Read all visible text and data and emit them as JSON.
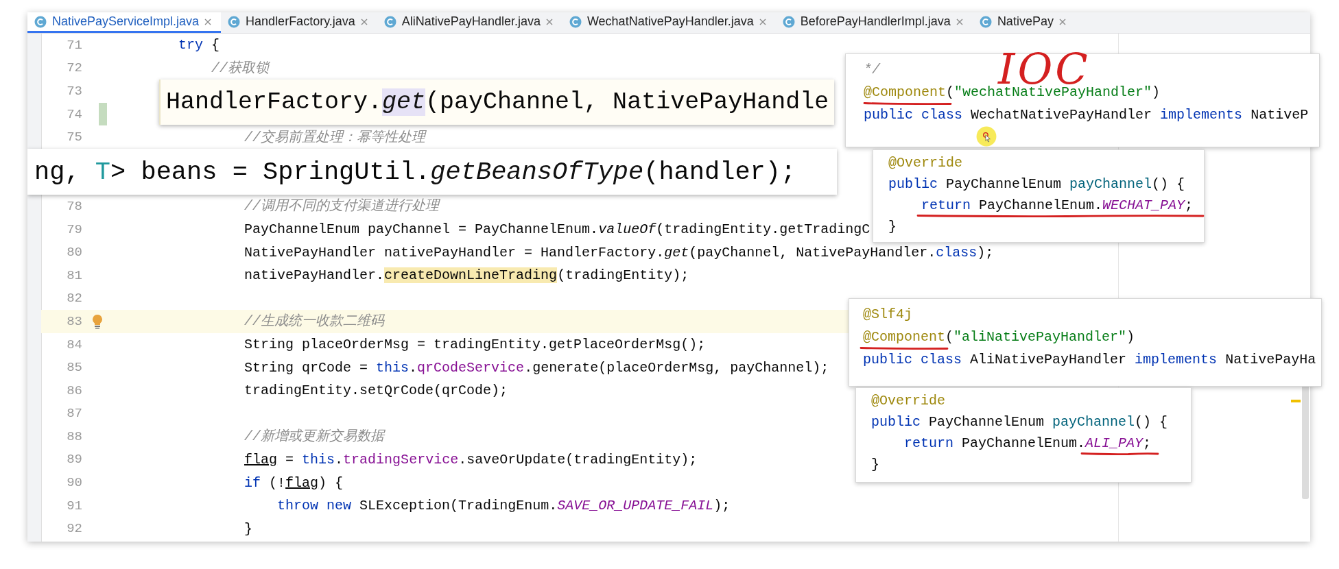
{
  "tabs": [
    {
      "label": "NativePayServiceImpl.java",
      "selected": true
    },
    {
      "label": "HandlerFactory.java",
      "selected": false
    },
    {
      "label": "AliNativePayHandler.java",
      "selected": false
    },
    {
      "label": "WechatNativePayHandler.java",
      "selected": false
    },
    {
      "label": "BeforePayHandlerImpl.java",
      "selected": false
    },
    {
      "label": "NativePay",
      "selected": false
    }
  ],
  "zoom_callout": {
    "tokens": [
      {
        "text": "HandlerFactory.",
        "kind": "plain"
      },
      {
        "text": "get",
        "kind": "static_highlight"
      },
      {
        "text": "(payChannel, NativePayHandle",
        "kind": "plain"
      }
    ]
  },
  "editor": {
    "rows": [
      {
        "kind": "line",
        "number": "71",
        "current": false,
        "changed": false,
        "bulb": false,
        "tokens": [
          {
            "text": "        try",
            "kind": "keyword"
          },
          {
            "text": " {",
            "kind": "plain"
          }
        ]
      },
      {
        "kind": "line",
        "number": "72",
        "current": false,
        "changed": false,
        "bulb": false,
        "tokens": [
          {
            "text": "            //获取锁",
            "kind": "comment"
          }
        ]
      },
      {
        "kind": "line",
        "number": "73",
        "current": false,
        "changed": false,
        "bulb": false
      },
      {
        "kind": "line",
        "number": "74",
        "current": false,
        "changed": true,
        "bulb": false
      },
      {
        "kind": "line",
        "number": "75",
        "current": false,
        "changed": false,
        "bulb": false,
        "tokens": [
          {
            "text": "                //交易前置处理：幂等性处理",
            "kind": "comment"
          }
        ]
      },
      {
        "kind": "zoom_callout",
        "tokens": [
          {
            "text": "ng, ",
            "kind": "plain"
          },
          {
            "text": "T",
            "kind": "type_param"
          },
          {
            "text": "> beans = SpringUtil.",
            "kind": "plain"
          },
          {
            "text": "getBeansOfType",
            "kind": "static"
          },
          {
            "text": "(handler);",
            "kind": "plain"
          }
        ]
      },
      {
        "kind": "line",
        "number": "78",
        "current": false,
        "changed": false,
        "bulb": false,
        "tokens": [
          {
            "text": "                //调用不同的支付渠道进行处理",
            "kind": "comment"
          }
        ]
      },
      {
        "kind": "line",
        "number": "79",
        "current": false,
        "changed": false,
        "bulb": false,
        "tokens": [
          {
            "text": "                PayChannelEnum payChannel = PayChannelEnum.",
            "kind": "plain"
          },
          {
            "text": "valueOf",
            "kind": "static"
          },
          {
            "text": "(tradingEntity.getTradingC",
            "kind": "plain"
          }
        ]
      },
      {
        "kind": "line",
        "number": "80",
        "current": false,
        "changed": false,
        "bulb": false,
        "tokens": [
          {
            "text": "                NativePayHandler nativePayHandler = HandlerFactory.",
            "kind": "plain"
          },
          {
            "text": "get",
            "kind": "static"
          },
          {
            "text": "(payChannel, NativePayHandler.",
            "kind": "plain"
          },
          {
            "text": "class",
            "kind": "keyword"
          },
          {
            "text": ");",
            "kind": "plain"
          }
        ]
      },
      {
        "kind": "line",
        "number": "81",
        "current": false,
        "changed": false,
        "bulb": false,
        "tokens": [
          {
            "text": "                nativePayHandler.",
            "kind": "plain"
          },
          {
            "text": "createDownLineTrading",
            "kind": "highlight"
          },
          {
            "text": "(tradingEntity);",
            "kind": "plain"
          }
        ]
      },
      {
        "kind": "line",
        "number": "82",
        "current": false,
        "changed": false,
        "bulb": false
      },
      {
        "kind": "line",
        "number": "83",
        "current": true,
        "changed": false,
        "bulb": true,
        "tokens": [
          {
            "text": "                //生成统一收款二维码",
            "kind": "comment"
          }
        ]
      },
      {
        "kind": "line",
        "number": "84",
        "current": false,
        "changed": false,
        "bulb": false,
        "tokens": [
          {
            "text": "                String placeOrderMsg = tradingEntity.getPlaceOrderMsg();",
            "kind": "plain"
          }
        ]
      },
      {
        "kind": "line",
        "number": "85",
        "current": false,
        "changed": false,
        "bulb": false,
        "tokens": [
          {
            "text": "                String qrCode = ",
            "kind": "plain"
          },
          {
            "text": "this",
            "kind": "keyword"
          },
          {
            "text": ".",
            "kind": "plain"
          },
          {
            "text": "qrCodeService",
            "kind": "field"
          },
          {
            "text": ".generate(placeOrderMsg, payChannel);",
            "kind": "plain"
          }
        ]
      },
      {
        "kind": "line",
        "number": "86",
        "current": false,
        "changed": false,
        "bulb": false,
        "tokens": [
          {
            "text": "                tradingEntity.setQrCode(qrCode);",
            "kind": "plain"
          }
        ]
      },
      {
        "kind": "line",
        "number": "87",
        "current": false,
        "changed": false,
        "bulb": false
      },
      {
        "kind": "line",
        "number": "88",
        "current": false,
        "changed": false,
        "bulb": false,
        "tokens": [
          {
            "text": "                //新增或更新交易数据",
            "kind": "comment"
          }
        ]
      },
      {
        "kind": "line",
        "number": "89",
        "current": false,
        "changed": false,
        "bulb": false,
        "tokens": [
          {
            "text": "                flag",
            "kind": "underlined"
          },
          {
            "text": " = ",
            "kind": "plain"
          },
          {
            "text": "this",
            "kind": "keyword"
          },
          {
            "text": ".",
            "kind": "plain"
          },
          {
            "text": "tradingService",
            "kind": "field"
          },
          {
            "text": ".saveOrUpdate(tradingEntity);",
            "kind": "plain"
          }
        ]
      },
      {
        "kind": "line",
        "number": "90",
        "current": false,
        "changed": false,
        "bulb": false,
        "tokens": [
          {
            "text": "                if",
            "kind": "keyword"
          },
          {
            "text": " (!",
            "kind": "plain"
          },
          {
            "text": "flag",
            "kind": "underlined"
          },
          {
            "text": ") {",
            "kind": "plain"
          }
        ]
      },
      {
        "kind": "line",
        "number": "91",
        "current": false,
        "changed": false,
        "bulb": false,
        "tokens": [
          {
            "text": "                    throw new",
            "kind": "keyword"
          },
          {
            "text": " SLException(TradingEnum.",
            "kind": "plain"
          },
          {
            "text": "SAVE_OR_UPDATE_FAIL",
            "kind": "enum"
          },
          {
            "text": ");",
            "kind": "plain"
          }
        ]
      },
      {
        "kind": "line",
        "number": "92",
        "current": false,
        "changed": false,
        "bulb": false,
        "tokens": [
          {
            "text": "                }",
            "kind": "plain"
          }
        ]
      }
    ]
  },
  "peek_popups": [
    {
      "lines": [
        [
          {
            "text": "*/",
            "kind": "comment"
          }
        ],
        [
          {
            "text": "@Component",
            "kind": "annotation"
          },
          {
            "text": "(",
            "kind": "plain"
          },
          {
            "text": "\"wechatNativePayHandler\"",
            "kind": "string"
          },
          {
            "text": ")",
            "kind": "plain"
          }
        ],
        [
          {
            "text": "public class",
            "kind": "keyword"
          },
          {
            "text": " WechatNativePayHandler ",
            "kind": "plain"
          },
          {
            "text": "implements",
            "kind": "keyword"
          },
          {
            "text": " NativeP",
            "kind": "plain"
          }
        ]
      ]
    },
    {
      "lines": [
        [
          {
            "text": "@Override",
            "kind": "annotation"
          }
        ],
        [
          {
            "text": "public",
            "kind": "keyword"
          },
          {
            "text": " PayChannelEnum ",
            "kind": "plain"
          },
          {
            "text": "payChannel",
            "kind": "method"
          },
          {
            "text": "() {",
            "kind": "plain"
          }
        ],
        [
          {
            "text": "    return",
            "kind": "keyword"
          },
          {
            "text": " PayChannelEnum.",
            "kind": "plain"
          },
          {
            "text": "WECHAT_PAY",
            "kind": "enum"
          },
          {
            "text": ";",
            "kind": "plain"
          }
        ],
        [
          {
            "text": "}",
            "kind": "plain"
          }
        ]
      ]
    },
    {
      "lines": [
        [
          {
            "text": "@Slf4j",
            "kind": "annotation"
          }
        ],
        [
          {
            "text": "@Component",
            "kind": "annotation"
          },
          {
            "text": "(",
            "kind": "plain"
          },
          {
            "text": "\"aliNativePayHandler\"",
            "kind": "string"
          },
          {
            "text": ")",
            "kind": "plain"
          }
        ],
        [
          {
            "text": "public class",
            "kind": "keyword"
          },
          {
            "text": " AliNativePayHandler ",
            "kind": "plain"
          },
          {
            "text": "implements",
            "kind": "keyword"
          },
          {
            "text": " NativePayHa",
            "kind": "plain"
          }
        ]
      ]
    },
    {
      "lines": [
        [
          {
            "text": "@Override",
            "kind": "annotation"
          }
        ],
        [
          {
            "text": "public",
            "kind": "keyword"
          },
          {
            "text": " PayChannelEnum ",
            "kind": "plain"
          },
          {
            "text": "payChannel",
            "kind": "method"
          },
          {
            "text": "() {",
            "kind": "plain"
          }
        ],
        [
          {
            "text": "    return",
            "kind": "keyword"
          },
          {
            "text": " PayChannelEnum.",
            "kind": "plain"
          },
          {
            "text": "ALI_PAY",
            "kind": "enum"
          },
          {
            "text": ";",
            "kind": "plain"
          }
        ],
        [
          {
            "text": "}",
            "kind": "plain"
          }
        ]
      ]
    }
  ],
  "handwritten_note": "IOC"
}
